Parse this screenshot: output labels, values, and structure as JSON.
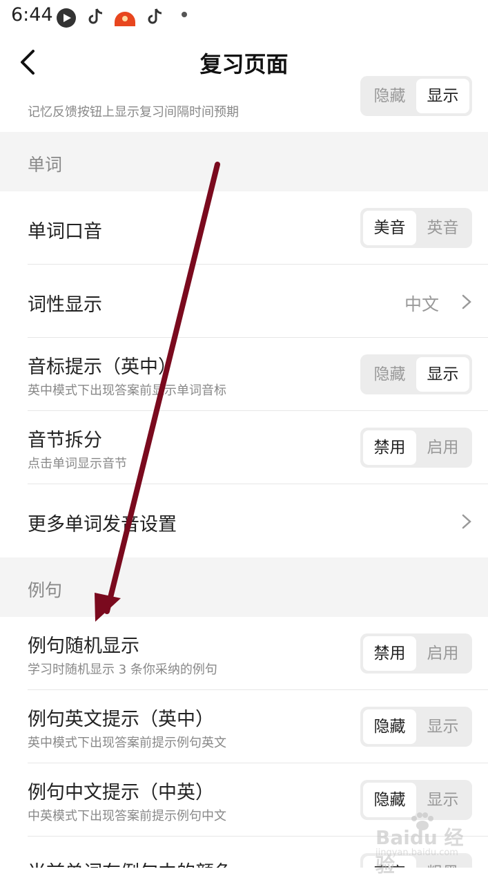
{
  "status_bar": {
    "time": "6:44",
    "icons": [
      "video-app-icon",
      "tiktok-icon",
      "sunset-app-icon",
      "tiktok-icon",
      "dot-icon"
    ]
  },
  "nav": {
    "title": "复习页面",
    "back_icon": "chevron-left-icon"
  },
  "top_partial_row": {
    "subtitle": "记忆反馈按钮上显示复习间隔时间预期",
    "options": [
      "隐藏",
      "显示"
    ],
    "selected": 1
  },
  "sections": {
    "words": {
      "header": "单词",
      "rows": [
        {
          "title": "单词口音",
          "options": [
            "美音",
            "英音"
          ],
          "selected": 0
        },
        {
          "title": "词性显示",
          "value": "中文"
        },
        {
          "title": "音标提示（英中）",
          "subtitle": "英中模式下出现答案前显示单词音标",
          "options": [
            "隐藏",
            "显示"
          ],
          "selected": 1
        },
        {
          "title": "音节拆分",
          "subtitle": "点击单词显示音节",
          "options": [
            "禁用",
            "启用"
          ],
          "selected": 0
        },
        {
          "title": "更多单词发音设置"
        }
      ]
    },
    "sentences": {
      "header": "例句",
      "rows": [
        {
          "title": "例句随机显示",
          "subtitle": "学习时随机显示 3 条你采纳的例句",
          "options": [
            "禁用",
            "启用"
          ],
          "selected": 0
        },
        {
          "title": "例句英文提示（英中）",
          "subtitle": "英中模式下出现答案前提示例句英文",
          "options": [
            "隐藏",
            "显示"
          ],
          "selected": 0
        },
        {
          "title": "例句中文提示（中英）",
          "subtitle": "中英模式下出现答案前提示例句中文",
          "options": [
            "隐藏",
            "显示"
          ],
          "selected": 0
        },
        {
          "title": "当前单词在例句中的颜色",
          "options": [
            "高亮",
            "粗黑"
          ],
          "selected": 0
        }
      ]
    }
  },
  "watermark": {
    "brand": "Baidu 经验",
    "url": "jingyan.baidu.com"
  },
  "annotation": {
    "arrow_color": "#7a0a1e"
  }
}
